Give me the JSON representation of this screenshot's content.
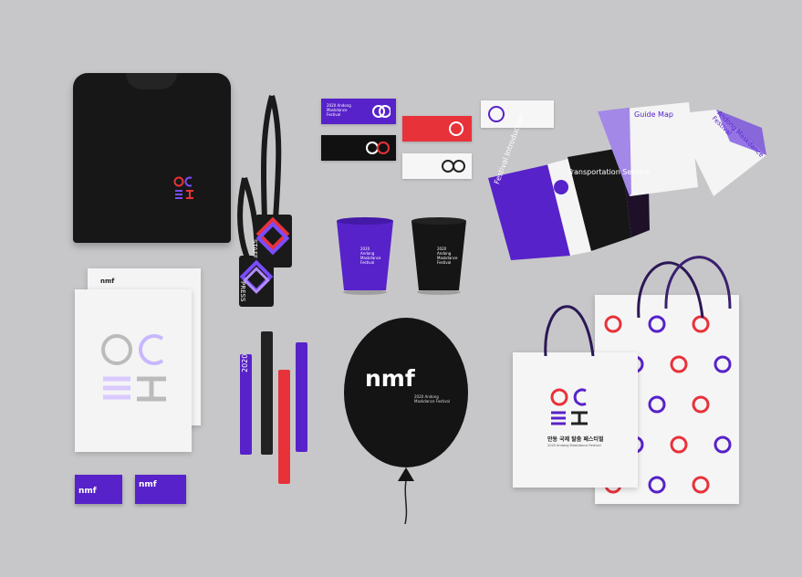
{
  "scene": {
    "background": "#c7c7c9",
    "accent_purple": "#5722c9",
    "accent_red": "#e8323a"
  },
  "balloon": {
    "logo": "nmf",
    "caption": "2020 Andong Maskdance Festival"
  },
  "cups": {
    "purple_text": "2020 Andong Maskdance Festival",
    "black_text": "2020 Andong Maskdance Festival"
  },
  "bag": {
    "korean": "안동 국제 탈춤 페스티벌",
    "english": "2020 Andong Maskdance Festival"
  },
  "business_cards": {
    "logo": "nmf"
  },
  "letterhead": {
    "logo": "nmf"
  },
  "lanyards": {
    "staff": "STAFF",
    "press": "PRESS"
  },
  "wristbands": {
    "year": "2020",
    "text": "Andong Maskdance Festival"
  },
  "brochures": {
    "guide_map": "Guide Map",
    "transportation": "Transportation Service",
    "festival": "Festival Introduction",
    "andong": "Andong Maskdance Festival"
  },
  "tickets": {
    "t1": "2020 Andong Maskdance Festival"
  }
}
